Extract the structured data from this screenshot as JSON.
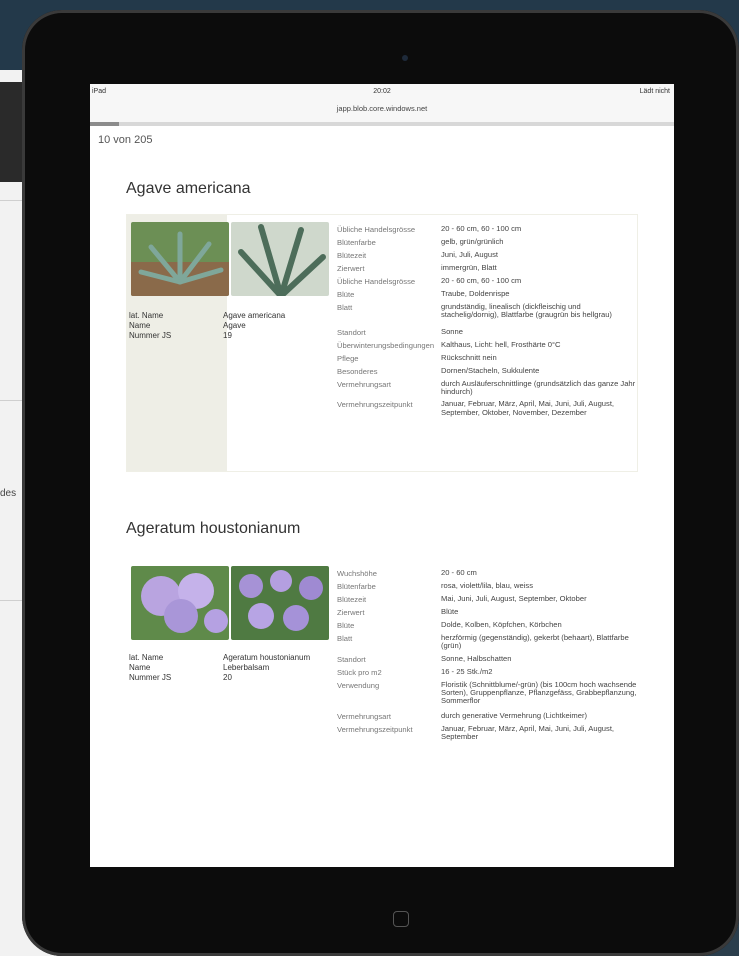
{
  "background": {
    "side_text": "des"
  },
  "status_bar": {
    "device": "iPad",
    "time": "20:02",
    "charging": "Lädt nicht"
  },
  "url": "japp.blob.core.windows.net",
  "progress": 0.05,
  "counter": "10 von 205",
  "plants": [
    {
      "title": "Agave americana",
      "info": [
        {
          "label": "lat. Name",
          "value": "Agave americana"
        },
        {
          "label": "Name",
          "value": "Agave"
        },
        {
          "label": "Nummer JS",
          "value": "19"
        }
      ],
      "properties": [
        {
          "key": "Übliche Handelsgrösse",
          "value": "20 - 60 cm, 60 - 100 cm"
        },
        {
          "key": "Blütenfarbe",
          "value": "gelb, grün/grünlich"
        },
        {
          "key": "Blütezeit",
          "value": "Juni, Juli, August"
        },
        {
          "key": "Zierwert",
          "value": "immergrün, Blatt"
        },
        {
          "key": "Übliche Handelsgrösse",
          "value": "20 - 60 cm, 60 - 100 cm"
        },
        {
          "key": "Blüte",
          "value": "Traube, Doldenrispe"
        },
        {
          "key": "Blatt",
          "value": "grundständig, linealisch (dickfleischig und stachelig/dornig), Blattfarbe (graugrün bis hellgrau)"
        },
        {
          "key": "Standort",
          "value": "Sonne"
        },
        {
          "key": "Überwinterungsbedingungen",
          "value": "Kalthaus, Licht: hell, Frosthärte 0°C"
        },
        {
          "key": "Pflege",
          "value": "Rückschnitt nein"
        },
        {
          "key": "Besonderes",
          "value": "Dornen/Stacheln, Sukkulente"
        },
        {
          "key": "Vermehrungsart",
          "value": "durch Ausläuferschnittlinge (grundsätzlich das ganze Jahr hindurch)"
        },
        {
          "key": "Vermehrungszeitpunkt",
          "value": "Januar, Februar, März, April, Mai, Juni, Juli, August, September, Oktober, November, Dezember"
        }
      ]
    },
    {
      "title": "Ageratum houstonianum",
      "info": [
        {
          "label": "lat. Name",
          "value": "Ageratum houstonianum"
        },
        {
          "label": "Name",
          "value": "Leberbalsam"
        },
        {
          "label": "Nummer JS",
          "value": "20"
        }
      ],
      "properties": [
        {
          "key": "Wuchshöhe",
          "value": "20 - 60 cm"
        },
        {
          "key": "Blütenfarbe",
          "value": "rosa, violett/lila, blau, weiss"
        },
        {
          "key": "Blütezeit",
          "value": "Mai, Juni, Juli, August, September, Oktober"
        },
        {
          "key": "Zierwert",
          "value": "Blüte"
        },
        {
          "key": "Blüte",
          "value": "Dolde, Kolben, Köpfchen, Körbchen"
        },
        {
          "key": "Blatt",
          "value": "herzförmig (gegenständig), gekerbt (behaart), Blattfarbe (grün)"
        },
        {
          "key": "Standort",
          "value": "Sonne, Halbschatten"
        },
        {
          "key": "Stück pro m2",
          "value": "16 - 25 Stk./m2"
        },
        {
          "key": "Verwendung",
          "value": "Floristik (Schnittblume/-grün) (bis 100cm hoch wachsende Sorten), Gruppenpflanze, Pflanzgefäss, Grabbepflanzung, Sommerflor"
        },
        {
          "key": "Vermehrungsart",
          "value": "durch generative Vermehrung (Lichtkeimer)"
        },
        {
          "key": "Vermehrungszeitpunkt",
          "value": "Januar, Februar, März, April, Mai, Juni, Juli, August, September"
        }
      ]
    }
  ]
}
